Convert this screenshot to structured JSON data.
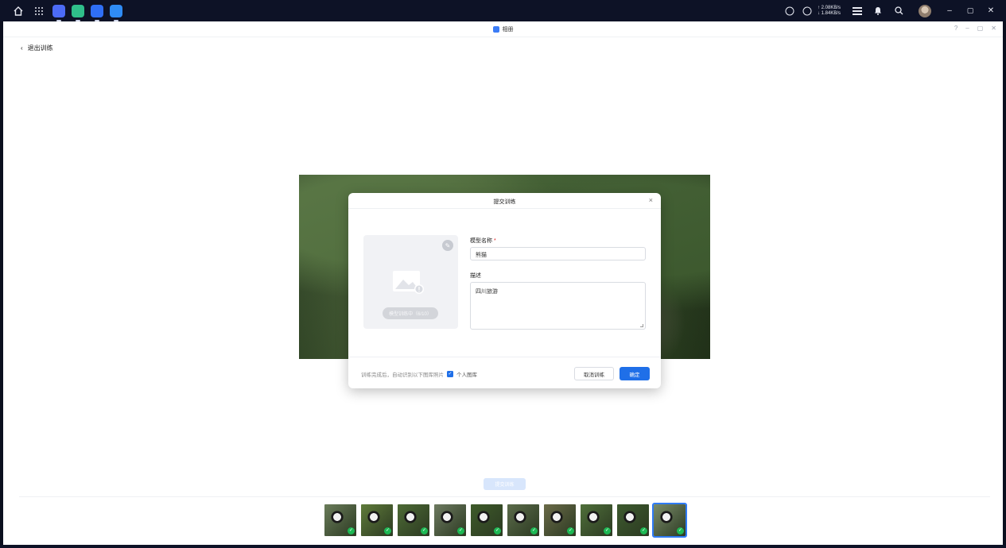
{
  "taskbar": {
    "left_icons": [
      "home-icon",
      "apps-grid-icon"
    ],
    "apps": [
      {
        "name": "video-app-icon",
        "color": "#4c6bf5"
      },
      {
        "name": "backup-app-icon",
        "color": "#2fbf8a"
      },
      {
        "name": "files-app-icon",
        "color": "#2f6ff5"
      },
      {
        "name": "photos-app-icon",
        "color": "#2f8cf5"
      }
    ],
    "net_up": "↑ 2.08KB/s",
    "net_down": "↓ 1.84KB/s"
  },
  "window": {
    "title": "相册",
    "back_label": "退出训练"
  },
  "modal": {
    "title": "提交训练",
    "cover_button": "模型训练中（6/10）",
    "name_label": "模型名称",
    "required_mark": "*",
    "name_value": "熊猫",
    "desc_label": "描述",
    "desc_value": "四川旅游",
    "footer_note": "训练完成后，自动识别以下图库照片",
    "checkbox_label": "个人图库",
    "cancel_label": "取消训练",
    "confirm_label": "确定"
  },
  "bottom": {
    "submit_label": "提交训练",
    "thumbnails": [
      {
        "color": "#6a7c5a"
      },
      {
        "color": "#5f7b3a"
      },
      {
        "color": "#4d6a35"
      },
      {
        "color": "#6d7a60"
      },
      {
        "color": "#3e5b2a"
      },
      {
        "color": "#5b6b4a"
      },
      {
        "color": "#6a6a48"
      },
      {
        "color": "#4f6f3a"
      },
      {
        "color": "#3d5a2e"
      },
      {
        "color": "#7a8c6a"
      }
    ]
  },
  "colors": {
    "accent": "#1f6fe8",
    "success": "#1db954"
  }
}
